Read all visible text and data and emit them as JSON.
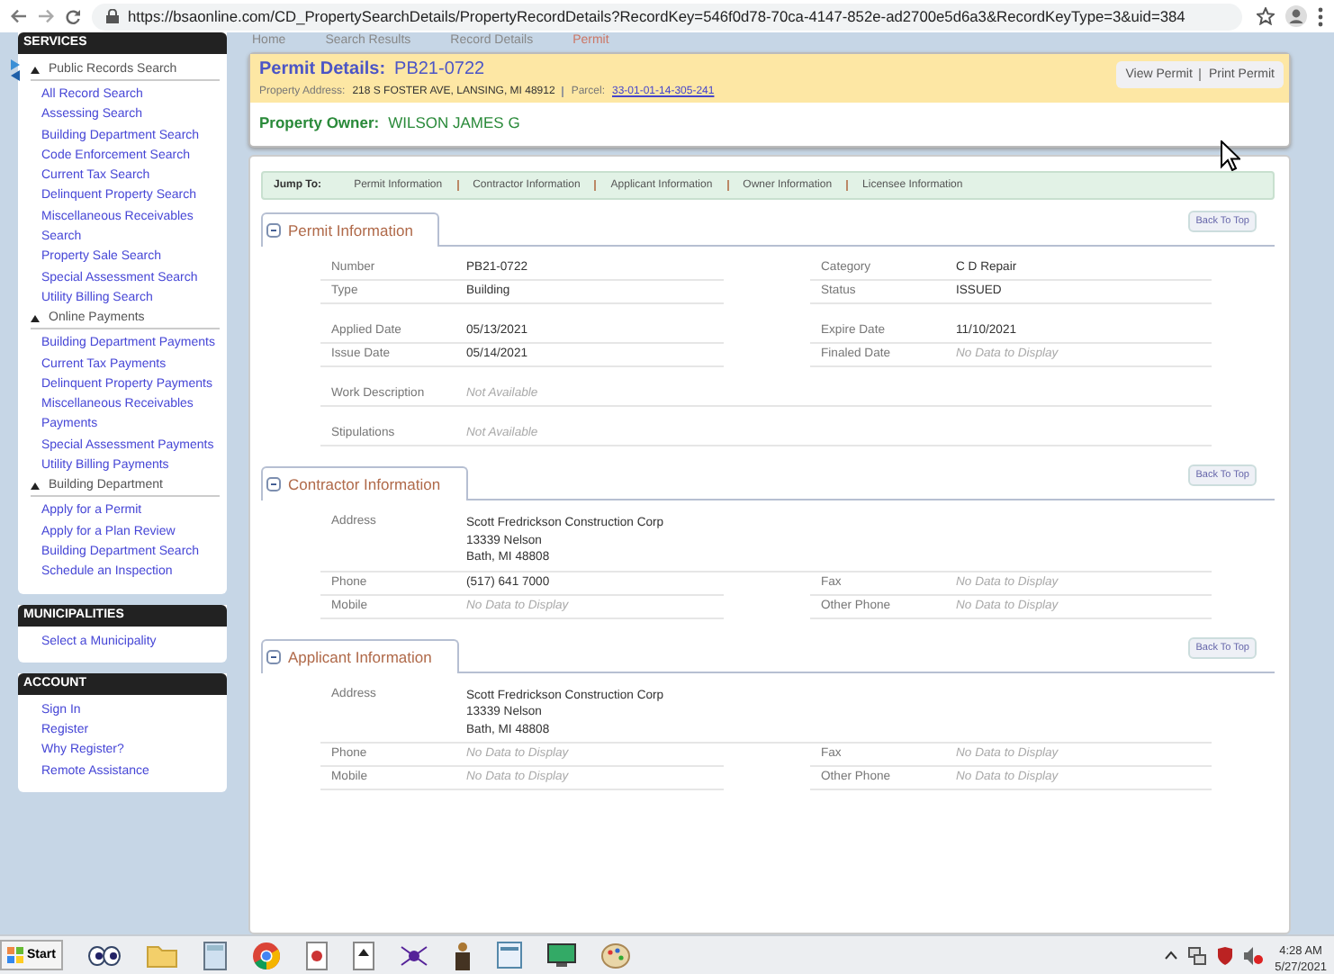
{
  "browser": {
    "url": "https://bsaonline.com/CD_PropertySearchDetails/PropertyRecordDetails?RecordKey=546f0d78-70ca-4147-852e-ad2700e5d6a3&RecordKeyType=3&uid=384"
  },
  "breadcrumb": [
    "Home",
    "Search Results",
    "Record Details",
    "Permit"
  ],
  "sidebar": [
    {
      "title": "SERVICES",
      "groups": [
        {
          "title": "Public Records Search",
          "links": [
            "All Record Search",
            "Assessing Search",
            "Building Department Search",
            "Code Enforcement Search",
            "Current Tax Search",
            "Delinquent Property Search",
            "Miscellaneous Receivables Search",
            "Property Sale Search",
            "Special Assessment Search",
            "Utility Billing Search"
          ]
        },
        {
          "title": "Online Payments",
          "links": [
            "Building Department Payments",
            "Current Tax Payments",
            "Delinquent Property Payments",
            "Miscellaneous Receivables Payments",
            "Special Assessment Payments",
            "Utility Billing Payments"
          ]
        },
        {
          "title": "Building Department",
          "links": [
            "Apply for a Permit",
            "Apply for a Plan Review",
            "Building Department Search",
            "Schedule an Inspection"
          ]
        }
      ]
    },
    {
      "title": "MUNICIPALITIES",
      "groups": [
        {
          "links": [
            "Select a Municipality"
          ]
        }
      ]
    },
    {
      "title": "ACCOUNT",
      "groups": [
        {
          "links": [
            "Sign In",
            "Register",
            "Why Register?",
            "Remote Assistance"
          ]
        }
      ]
    }
  ],
  "permit_header": {
    "label": "Permit Details:",
    "number": "PB21-0722",
    "address_label": "Property Address:",
    "address": "218 S FOSTER AVE,  LANSING, MI 48912",
    "parcel_label": "Parcel:",
    "parcel": "33-01-01-14-305-241",
    "owner_label": "Property Owner:",
    "owner": "WILSON JAMES G",
    "buttons": [
      "View Permit",
      "Print Permit"
    ]
  },
  "jump_to": {
    "label": "Jump To:",
    "links": [
      "Permit Information",
      "Contractor Information",
      "Applicant Information",
      "Owner Information",
      "Licensee Information"
    ]
  },
  "sections": [
    {
      "title": "Permit Information",
      "back_button": "Back To Top",
      "groups": [
        [
          [
            {
              "label": "Number",
              "value": "PB21-0722",
              "empty": false
            },
            {
              "label": "Category",
              "value": "C D Repair",
              "empty": false
            }
          ],
          [
            {
              "label": "Type",
              "value": "Building",
              "empty": false
            },
            {
              "label": "Status",
              "value": "ISSUED",
              "empty": false
            }
          ]
        ],
        [
          [
            {
              "label": "Applied Date",
              "value": "05/13/2021",
              "empty": false
            },
            {
              "label": "Expire Date",
              "value": "11/10/2021",
              "empty": false
            }
          ],
          [
            {
              "label": "Issue Date",
              "value": "05/14/2021",
              "empty": false
            },
            {
              "label": "Finaled Date",
              "value": "No Data to Display",
              "empty": true
            }
          ]
        ],
        [
          [
            {
              "label": "Work Description",
              "value": "Not Available",
              "empty": true
            }
          ]
        ],
        [
          [
            {
              "label": "Stipulations",
              "value": "Not Available",
              "empty": true
            }
          ]
        ]
      ]
    },
    {
      "title": "Contractor Information",
      "back_button": "Back To Top",
      "groups": [
        [
          [
            {
              "label": "Address",
              "lines": [
                "Scott Fredrickson Construction Corp",
                "13339 Nelson",
                "Bath, MI 48808"
              ],
              "empty": false
            }
          ],
          [
            {
              "label": "Phone",
              "value": "(517) 641 7000",
              "empty": false
            },
            {
              "label": "Fax",
              "value": "No Data to Display",
              "empty": true
            }
          ],
          [
            {
              "label": "Mobile",
              "value": "No Data to Display",
              "empty": true
            },
            {
              "label": "Other Phone",
              "value": "No Data to Display",
              "empty": true
            }
          ]
        ]
      ]
    },
    {
      "title": "Applicant Information",
      "back_button": "Back To Top",
      "groups": [
        [
          [
            {
              "label": "Address",
              "lines": [
                "Scott Fredrickson Construction Corp",
                "13339 Nelson",
                "Bath, MI 48808"
              ],
              "empty": false
            }
          ],
          [
            {
              "label": "Phone",
              "value": "No Data to Display",
              "empty": true
            },
            {
              "label": "Fax",
              "value": "No Data to Display",
              "empty": true
            }
          ],
          [
            {
              "label": "Mobile",
              "value": "No Data to Display",
              "empty": true
            },
            {
              "label": "Other Phone",
              "value": "No Data to Display",
              "empty": true
            }
          ]
        ]
      ]
    }
  ],
  "taskbar": {
    "start": "Start",
    "time": "4:28 AM",
    "date": "5/27/2021"
  }
}
